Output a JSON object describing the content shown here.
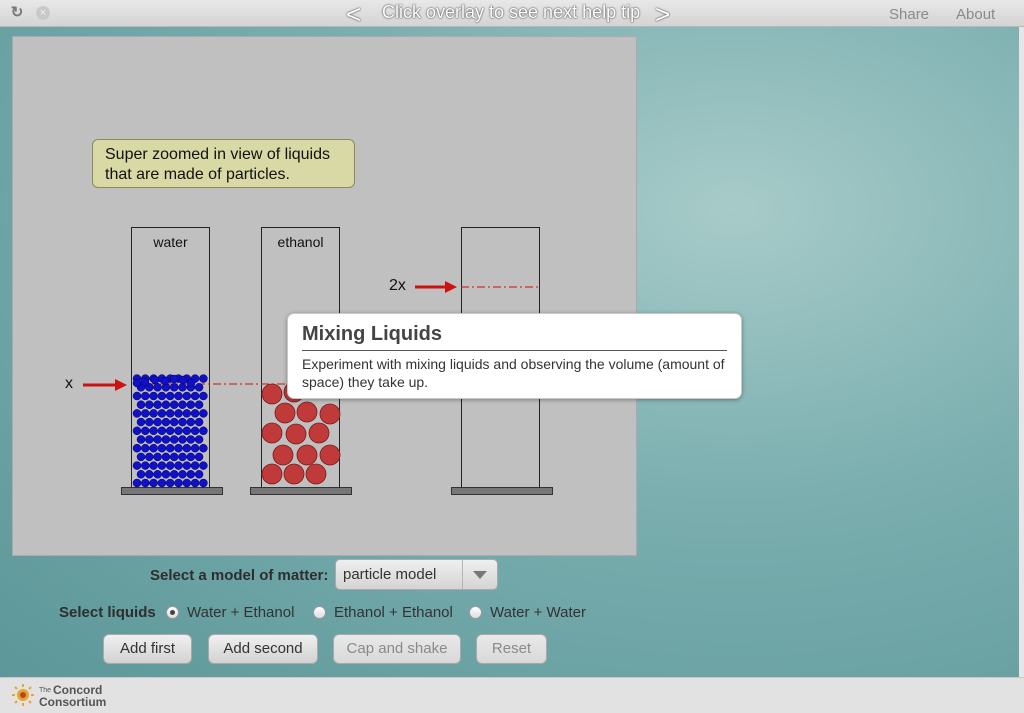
{
  "topbar": {
    "reload_icon": "↻",
    "close_icon": "×",
    "help_prev": "<",
    "help_tip": "Click overlay to see next help tip",
    "help_next": ">",
    "share": "Share",
    "about": "About"
  },
  "sim": {
    "note": "Super zoomed in view of liquids that are made of particles.",
    "beakers": [
      {
        "label": "water"
      },
      {
        "label": "ethanol"
      },
      {
        "label": ""
      }
    ],
    "marker_x": "x",
    "marker_2x": "2x",
    "colors": {
      "water_particle": "#1010c8",
      "ethanol_particle": "#c03a3a",
      "arrow": "#cc1111",
      "canvas": "#c0c0c0"
    }
  },
  "popup": {
    "title": "Mixing Liquids",
    "body": "Experiment with mixing liquids and observing the volume (amount of space) they take up."
  },
  "controls": {
    "model_label": "Select a model of matter:",
    "model_value": "particle model",
    "liquids_label": "Select liquids",
    "liquid_options": [
      {
        "label": "Water + Ethanol",
        "selected": true
      },
      {
        "label": "Ethanol + Ethanol",
        "selected": false
      },
      {
        "label": "Water + Water",
        "selected": false
      }
    ],
    "buttons": {
      "add_first": "Add first",
      "add_second": "Add second",
      "cap_shake": "Cap and shake",
      "reset": "Reset"
    }
  },
  "footer": {
    "logo_the": "The",
    "logo_line1": "Concord",
    "logo_line2": "Consortium"
  }
}
